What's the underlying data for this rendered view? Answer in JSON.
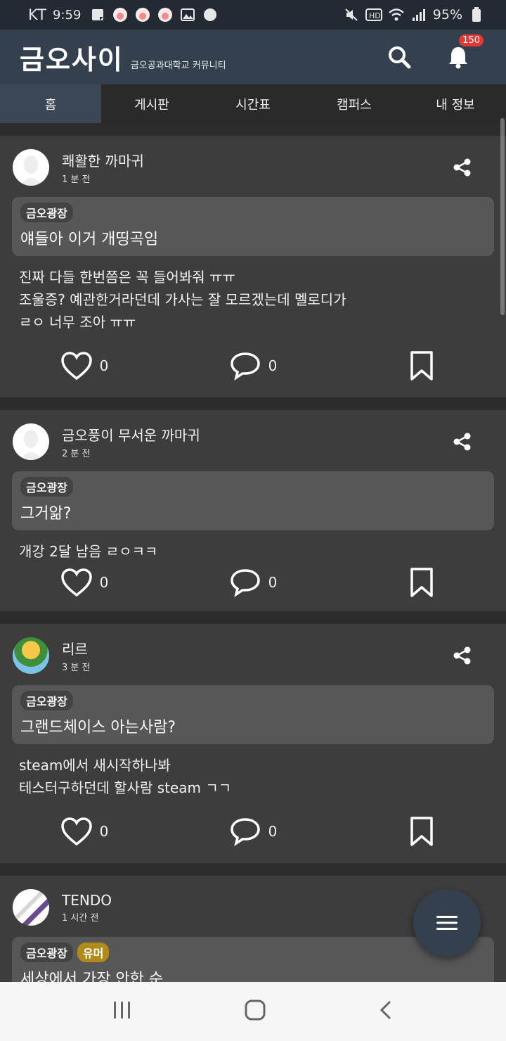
{
  "status_bar": {
    "carrier": "KT",
    "time": "9:59",
    "battery": "95%"
  },
  "app_bar": {
    "logo": "금오사이",
    "subtitle": "금오공과대학교 커뮤니티",
    "notification_count": "150"
  },
  "tabs": [
    {
      "label": "홈",
      "active": true
    },
    {
      "label": "게시판"
    },
    {
      "label": "시간표"
    },
    {
      "label": "캠퍼스"
    },
    {
      "label": "내 정보"
    }
  ],
  "posts": [
    {
      "author": "쾌활한 까마귀",
      "time": "1 분 전",
      "tags": [
        "금오광장"
      ],
      "title": "얘들아 이거 개띵곡임",
      "body": "진짜 다들 한번쯤은 꼭 들어봐줘 ㅠㅠ\n조울증? 예관한거라던데 가사는 잘 모르겠는데 멜로디가\nㄹㅇ 너무 조아 ㅠㅠ",
      "likes": "0",
      "comments": "0"
    },
    {
      "author": "금오풍이 무서운 까마귀",
      "time": "2 분 전",
      "tags": [
        "금오광장"
      ],
      "title": "그거앎?",
      "body": "개강 2달 남음 ㄹㅇㅋㅋ",
      "likes": "0",
      "comments": "0"
    },
    {
      "author": "리르",
      "time": "3 분 전",
      "tags": [
        "금오광장"
      ],
      "title": "그랜드체이스 아는사람?",
      "body": "steam에서 새시작하나봐\n테스터구하던데 할사람 steam ㄱㄱ",
      "likes": "0",
      "comments": "0"
    },
    {
      "author": "TENDO",
      "time": "1 시간 전",
      "tags": [
        "금오광장",
        "유머"
      ],
      "title": "세상에서 가장 안한 순"
    }
  ],
  "icons": {
    "search": "search-icon",
    "bell": "bell-icon",
    "share": "share-icon",
    "heart": "heart-icon",
    "comment": "comment-icon",
    "bookmark": "bookmark-icon",
    "menu": "menu-icon"
  },
  "colors": {
    "app_bar": "#34404d",
    "badge": "#e53935",
    "tag_humor": "#b08a1a"
  }
}
